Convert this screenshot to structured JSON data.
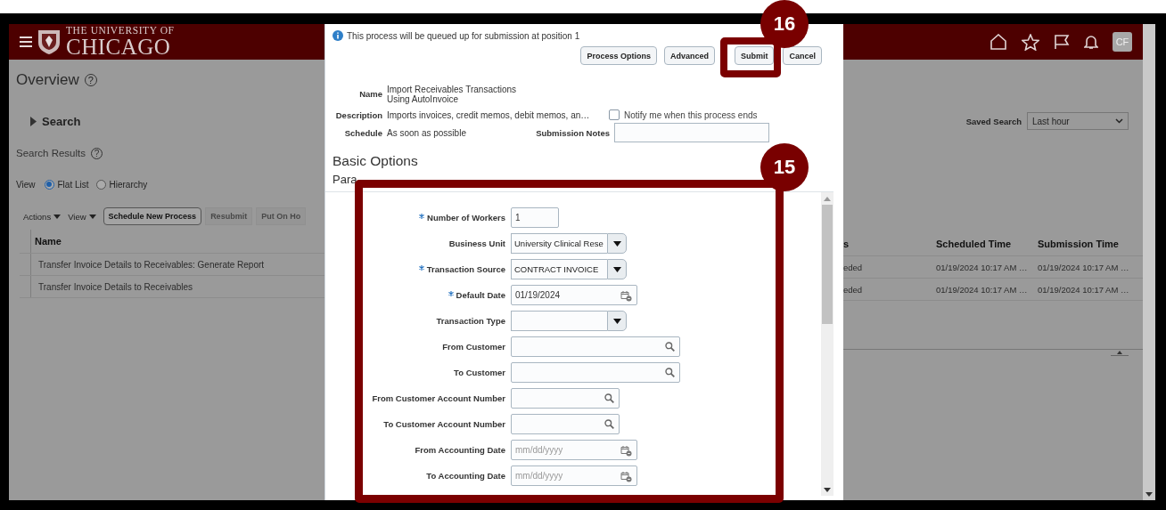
{
  "header": {
    "logo_line1": "THE UNIVERSITY OF",
    "logo_line2": "CHICAGO",
    "avatar": "CF"
  },
  "page": {
    "title": "Overview",
    "help": "?",
    "search_label": "Search",
    "saved_search": {
      "label": "Saved Search",
      "value": "Last hour"
    },
    "results_title": "Search Results",
    "results_help": "?",
    "view": {
      "label": "View",
      "options": [
        {
          "label": "Flat List",
          "selected": true
        },
        {
          "label": "Hierarchy",
          "selected": false
        }
      ]
    },
    "toolbar": [
      {
        "label": "Actions",
        "kind": "menu"
      },
      {
        "label": "View",
        "kind": "menu"
      },
      {
        "label": "Schedule New Process",
        "kind": "button",
        "disabled": false
      },
      {
        "label": "Resubmit",
        "kind": "button",
        "disabled": true
      },
      {
        "label": "Put On Ho",
        "kind": "button",
        "disabled": true
      }
    ],
    "table": {
      "columns": [
        "Name",
        "s",
        "Scheduled Time",
        "Submission Time"
      ],
      "rows": [
        [
          "Transfer Invoice Details to Receivables: Generate Report",
          "eded",
          "01/19/2024 10:17 AM …",
          "01/19/2024 10:17 AM …"
        ],
        [
          "Transfer Invoice Details to Receivables",
          "eded",
          "01/19/2024 10:17 AM …",
          "01/19/2024 10:17 AM …"
        ]
      ]
    }
  },
  "dialog": {
    "notice": "This process will be queued up for submission at position 1",
    "buttons": [
      "Process Options",
      "Advanced",
      "Submit",
      "Cancel"
    ],
    "name_label": "Name",
    "name": "Import Receivables Transactions Using AutoInvoice",
    "description_label": "Description",
    "description": "Imports invoices, credit memos, debit memos, an…",
    "notify": {
      "label": "Notify me when this process ends",
      "checked": false
    },
    "schedule_label": "Schedule",
    "schedule": "As soon as possible",
    "notes_label": "Submission Notes",
    "section": "Basic Options",
    "subsection": "Para",
    "parameters": [
      {
        "label": "Number of Workers",
        "required": true,
        "kind": "text",
        "value": "1"
      },
      {
        "label": "Business Unit",
        "required": false,
        "kind": "select",
        "value": "University Clinical Rese"
      },
      {
        "label": "Transaction Source",
        "required": true,
        "kind": "select",
        "value": "CONTRACT INVOICE"
      },
      {
        "label": "Default Date",
        "required": true,
        "kind": "date",
        "value": "01/19/2024"
      },
      {
        "label": "Transaction Type",
        "required": false,
        "kind": "select"
      },
      {
        "label": "From Customer",
        "required": false,
        "kind": "search"
      },
      {
        "label": "To Customer",
        "required": false,
        "kind": "search"
      },
      {
        "label": "From Customer Account Number",
        "required": false,
        "kind": "lookup"
      },
      {
        "label": "To Customer Account Number",
        "required": false,
        "kind": "lookup"
      },
      {
        "label": "From Accounting Date",
        "required": false,
        "kind": "date",
        "placeholder": "mm/dd/yyyy"
      },
      {
        "label": "To Accounting Date",
        "required": false,
        "kind": "date",
        "placeholder": "mm/dd/yyyy"
      }
    ]
  },
  "annotations": [
    {
      "number": "16"
    },
    {
      "number": "15"
    }
  ]
}
